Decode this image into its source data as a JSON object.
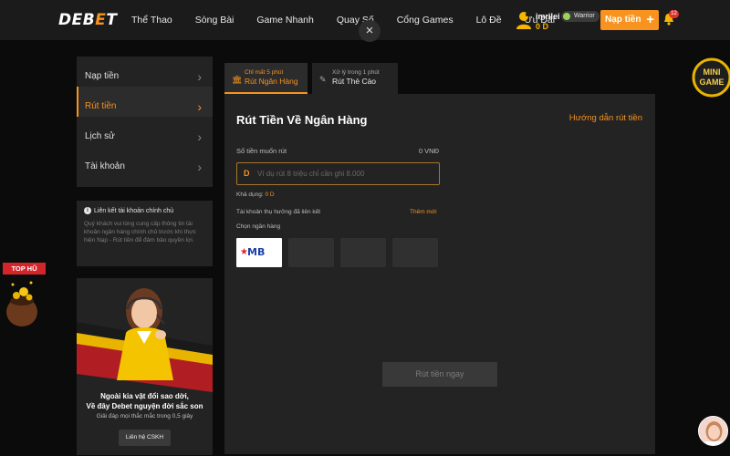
{
  "header": {
    "logo_prefix": "DEB",
    "logo_o": "E",
    "logo_suffix": "T",
    "nav": [
      "Thể Thao",
      "Sòng Bài",
      "Game Nhanh",
      "Quay Số",
      "Cổng Games",
      "Lô Đề",
      "Ưu Đãi"
    ],
    "username": "imrilei",
    "balance": "0 D",
    "rank": "Warrior",
    "deposit_label": "Nạp tiền",
    "notification_count": "12",
    "close_symbol": "×"
  },
  "sidebar": {
    "items": [
      {
        "label": "Nạp tiền",
        "active": false
      },
      {
        "label": "Rút tiền",
        "active": true
      },
      {
        "label": "Lịch sử",
        "active": false
      },
      {
        "label": "Tài khoản",
        "active": false
      }
    ]
  },
  "info": {
    "title": "Liên kết tài khoản chính chủ",
    "body": "Quý khách vui lòng cung cấp thông tin tài khoản ngân hàng chính chủ trước khi thực hiện Nạp - Rút tiền để đảm bảo quyền lợi."
  },
  "support": {
    "title_line1": "Ngoài kia vật đổi sao dời,",
    "title_line2": "Về đây Debet nguyện đời sắc son",
    "subtitle": "Giải đáp mọi thắc mắc trong 0,5 giây",
    "button": "Liên hệ CSKH"
  },
  "tabs": [
    {
      "small": "Chỉ mất 5 phút",
      "label": "Rút Ngân Hàng",
      "active": true
    },
    {
      "small": "Xử lý trong 1 phút",
      "label": "Rút Thẻ Cào",
      "active": false
    }
  ],
  "withdraw": {
    "title": "Rút Tiền Về Ngân Hàng",
    "guide_link": "Hướng dẫn rút tiền",
    "amount_label": "Số tiền muốn rút",
    "amount_value": "0 VNĐ",
    "currency_symbol": "D",
    "amount_placeholder": "Ví dụ rút 8 triệu chỉ cần ghi 8.000",
    "available_label": "Khả dụng:",
    "available_value": "0 D",
    "linked_label": "Tài khoản thụ hưởng đã liên kết",
    "add_new": "Thêm mới",
    "choose_bank": "Chọn ngân hàng",
    "banks": [
      "MB"
    ],
    "submit": "Rút tiền ngay"
  },
  "floating": {
    "minigame_line1": "MINI",
    "minigame_line2": "GAME",
    "tophu": "TOP HŨ"
  },
  "colors": {
    "accent": "#f7931e",
    "background": "#0b0b0b",
    "panel": "#232323"
  }
}
